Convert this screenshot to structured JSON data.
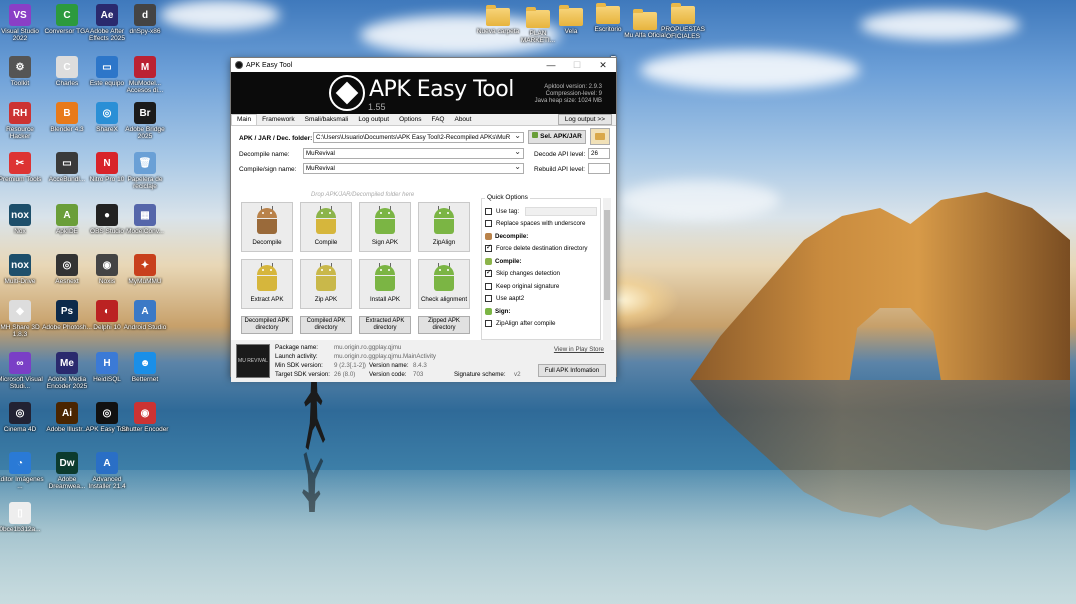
{
  "desktop": {
    "icons": [
      {
        "label": "Visual Studio 2022",
        "color": "#8a3fc6",
        "glyph": "VS"
      },
      {
        "label": "Conversor TGA",
        "color": "#2c9a3e",
        "glyph": "C"
      },
      {
        "label": "Adobe After Effects 2025",
        "color": "#2a2a6e",
        "glyph": "Ae"
      },
      {
        "label": "dnSpy-x86",
        "color": "#444",
        "glyph": "d"
      },
      {
        "label": "Toolkit",
        "color": "#555",
        "glyph": "⚙"
      },
      {
        "label": "Charles",
        "color": "#ddd",
        "glyph": "C"
      },
      {
        "label": "Este equipo",
        "color": "#2d76c9",
        "glyph": "▭"
      },
      {
        "label": "MuModel... Accesos di...",
        "color": "#b23",
        "glyph": "M"
      },
      {
        "label": "Resource Hacker",
        "color": "#c33",
        "glyph": "RH"
      },
      {
        "label": "Blender 4.3",
        "color": "#e87a1a",
        "glyph": "B"
      },
      {
        "label": "ShareX",
        "color": "#2a8fd6",
        "glyph": "◎"
      },
      {
        "label": "Adobe Bridge 2025",
        "color": "#1b1b1b",
        "glyph": "Br"
      },
      {
        "label": "Premium Tools",
        "color": "#d33",
        "glyph": "✂"
      },
      {
        "label": "AcceBundl...",
        "color": "#3a3a3a",
        "glyph": "▭"
      },
      {
        "label": "Nitro Pro 10",
        "color": "#d8232a",
        "glyph": "N"
      },
      {
        "label": "Papelera de reciclaje",
        "color": "#6aa0d6",
        "glyph": "🗑"
      },
      {
        "label": "Nox",
        "color": "#1d4f6b",
        "glyph": "nox"
      },
      {
        "label": "ApkIDE",
        "color": "#6a9e39",
        "glyph": "A"
      },
      {
        "label": "OBS Studio",
        "color": "#222",
        "glyph": "●"
      },
      {
        "label": "ModelConv...",
        "color": "#5566aa",
        "glyph": "▦"
      },
      {
        "label": "Multi-Drive",
        "color": "#1d4f6b",
        "glyph": "nox"
      },
      {
        "label": "Aesnext",
        "color": "#333",
        "glyph": "◎"
      },
      {
        "label": "Noxis",
        "color": "#444",
        "glyph": "◉"
      },
      {
        "label": "MyMuMMU",
        "color": "#c8401c",
        "glyph": "✦"
      },
      {
        "label": "MH Share 3D 1.8.3",
        "color": "#ddd",
        "glyph": "◆"
      },
      {
        "label": "Adobe Photosh...",
        "color": "#0d2a4a",
        "glyph": "Ps"
      },
      {
        "label": "Delphi 10",
        "color": "#b22",
        "glyph": "◐"
      },
      {
        "label": "Android Studio",
        "color": "#3b79c6",
        "glyph": "A"
      },
      {
        "label": "Microsoft Visual Studi...",
        "color": "#7a3fc6",
        "glyph": "∞"
      },
      {
        "label": "Adobe Media Encoder 2025",
        "color": "#2a2a6e",
        "glyph": "Me"
      },
      {
        "label": "HeidiSQL",
        "color": "#3b7ad6",
        "glyph": "H"
      },
      {
        "label": "Betternet",
        "color": "#1a8fe8",
        "glyph": "☻"
      },
      {
        "label": "Cinema 4D",
        "color": "#223",
        "glyph": "◎"
      },
      {
        "label": "Adobe Illustr...",
        "color": "#4a2500",
        "glyph": "Ai"
      },
      {
        "label": "APK Easy Tool",
        "color": "#111",
        "glyph": "◎"
      },
      {
        "label": "Shutter Encoder",
        "color": "#c33",
        "glyph": "◉"
      },
      {
        "label": "Editor Imágenes ...",
        "color": "#2a7ad6",
        "glyph": "◔"
      },
      {
        "label": "Adobe Dreamwea...",
        "color": "#0c3b2e",
        "glyph": "Dw"
      },
      {
        "label": "Advanced Installer 21.4",
        "color": "#2a6fc6",
        "glyph": "A"
      },
      {
        "label": "0bce1b312a...",
        "color": "#eee",
        "glyph": "▯"
      }
    ],
    "folders": [
      {
        "label": "Nueva carpeta"
      },
      {
        "label": "PLAN MARKETI..."
      },
      {
        "label": "Vela"
      },
      {
        "label": "Escritorio"
      },
      {
        "label": "Mu Alfa Oficial"
      },
      {
        "label": "PROPUESTAS OFICIALES"
      }
    ]
  },
  "window": {
    "title": "APK Easy Tool",
    "minimize": "—",
    "maximize": "☐",
    "close": "✕",
    "banner": {
      "name": "APK Easy Tool",
      "version": "1.55",
      "apktool_version": "Apktool version: 2.9.3",
      "compression": "Compression-level: 9",
      "heap": "Java heap size: 1024 MB"
    },
    "tabs": [
      "Main",
      "Framework",
      "Smali/baksmali",
      "Log output",
      "Options",
      "FAQ",
      "About"
    ],
    "log_output_button": "Log output >>",
    "form": {
      "apk_label": "APK / JAR / Dec. folder:",
      "apk_value": "C:\\Users\\Usuario\\Documents\\APK Easy Tool\\2-Recompiled APKs\\MuR",
      "sel_button": "Sel. APK/JAR",
      "decompile_name_label": "Decompile name:",
      "decompile_name_value": "MuRevival",
      "compile_name_label": "Compile/sign name:",
      "compile_name_value": "MuRevival",
      "decode_api_label": "Decode API level:",
      "decode_api_value": "26",
      "rebuild_api_label": "Rebuild API level:",
      "rebuild_api_value": "",
      "drop_hint": "Drop APK/JAR/Decompiled folder here"
    },
    "actions": {
      "decompile": "Decompile",
      "compile": "Compile",
      "sign": "Sign APK",
      "zipalign": "ZipAlign",
      "extract": "Extract APK",
      "zip": "Zip APK",
      "install": "Install APK",
      "check": "Check alignment"
    },
    "dirs": {
      "decompiled": "Decompiled APK directory",
      "compiled": "Compiled APK directory",
      "extracted": "Extracted APK directory",
      "zipped": "Zipped APK directory"
    },
    "quick": {
      "title": "Quick Options",
      "use_tag": "Use tag:",
      "replace_spaces": "Replace spaces with underscore",
      "decompile_section": "Decompile:",
      "force_delete": "Force delete destination directory",
      "compile_section": "Compile:",
      "skip_changes": "Skip changes detection",
      "keep_signature": "Keep original signature",
      "use_aapt2": "Use aapt2",
      "sign_section": "Sign:",
      "zipalign_after": "ZipAlign after compile"
    },
    "apkinfo": {
      "app_image_text": "MU REVIVAL",
      "package_label": "Package name:",
      "package_value": "mu.origin.ro.ggplay.qjmu",
      "launch_label": "Launch activity:",
      "launch_value": "mu.origin.ro.ggplay.qjmu.MainActivity",
      "min_sdk_label": "Min SDK version:",
      "min_sdk_value": "9 (2.3[.1-2])",
      "target_sdk_label": "Target SDK version:",
      "target_sdk_value": "26 (8.0)",
      "version_name_label": "Version name:",
      "version_name_value": "8.4.3",
      "version_code_label": "Version code:",
      "version_code_value": "703",
      "scheme_label": "Signature scheme:",
      "scheme_value": "v2",
      "play_store_link": "View in Play Store",
      "full_info_button": "Full APK Infomation"
    }
  }
}
